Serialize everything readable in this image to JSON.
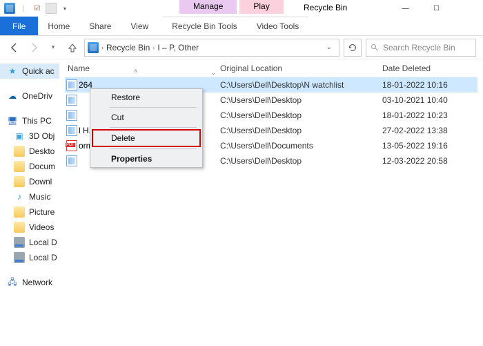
{
  "window": {
    "title": "Recycle Bin",
    "min": "—",
    "max": "☐",
    "close": ""
  },
  "context_tabs": {
    "manage": "Manage",
    "play": "Play",
    "tools1": "Recycle Bin Tools",
    "tools2": "Video Tools"
  },
  "ribbon": {
    "file": "File",
    "home": "Home",
    "share": "Share",
    "view": "View"
  },
  "nav": {
    "crumb1": "Recycle Bin",
    "crumb2": "I – P, Other",
    "search_placeholder": "Search Recycle Bin"
  },
  "sidebar": {
    "quick": "Quick ac",
    "onedrive": "OneDriv",
    "thispc": "This PC",
    "obj3d": "3D Obj",
    "desktop": "Deskto",
    "documents": "Docum",
    "downloads": "Downl",
    "music": "Music",
    "pictures": "Picture",
    "videos": "Videos",
    "localc": "Local D",
    "locald": "Local D",
    "network": "Network"
  },
  "columns": {
    "name": "Name",
    "ol": "Original Location",
    "dd": "Date Deleted"
  },
  "rows": [
    {
      "name": "                                      264",
      "ol": "C:\\Users\\Dell\\Desktop\\N watchlist",
      "dd": "18-01-2022 10:16",
      "icon": "vid",
      "sel": true
    },
    {
      "name": "",
      "ol": "C:\\Users\\Dell\\Desktop",
      "dd": "03-10-2021 10:40",
      "icon": "vid"
    },
    {
      "name": "",
      "ol": "C:\\Users\\Dell\\Desktop",
      "dd": "18-01-2022 10:23",
      "icon": "vid"
    },
    {
      "name": "                                    l H...",
      "ol": "C:\\Users\\Dell\\Desktop",
      "dd": "27-02-2022 13:38",
      "icon": "vid"
    },
    {
      "name": "                                  orm...",
      "ol": "C:\\Users\\Dell\\Documents",
      "dd": "13-05-2022 19:16",
      "icon": "pdf"
    },
    {
      "name": "",
      "ol": "C:\\Users\\Dell\\Desktop",
      "dd": "12-03-2022 20:58",
      "icon": "vid"
    }
  ],
  "menu": {
    "restore": "Restore",
    "cut": "Cut",
    "delete": "Delete",
    "properties": "Properties"
  }
}
